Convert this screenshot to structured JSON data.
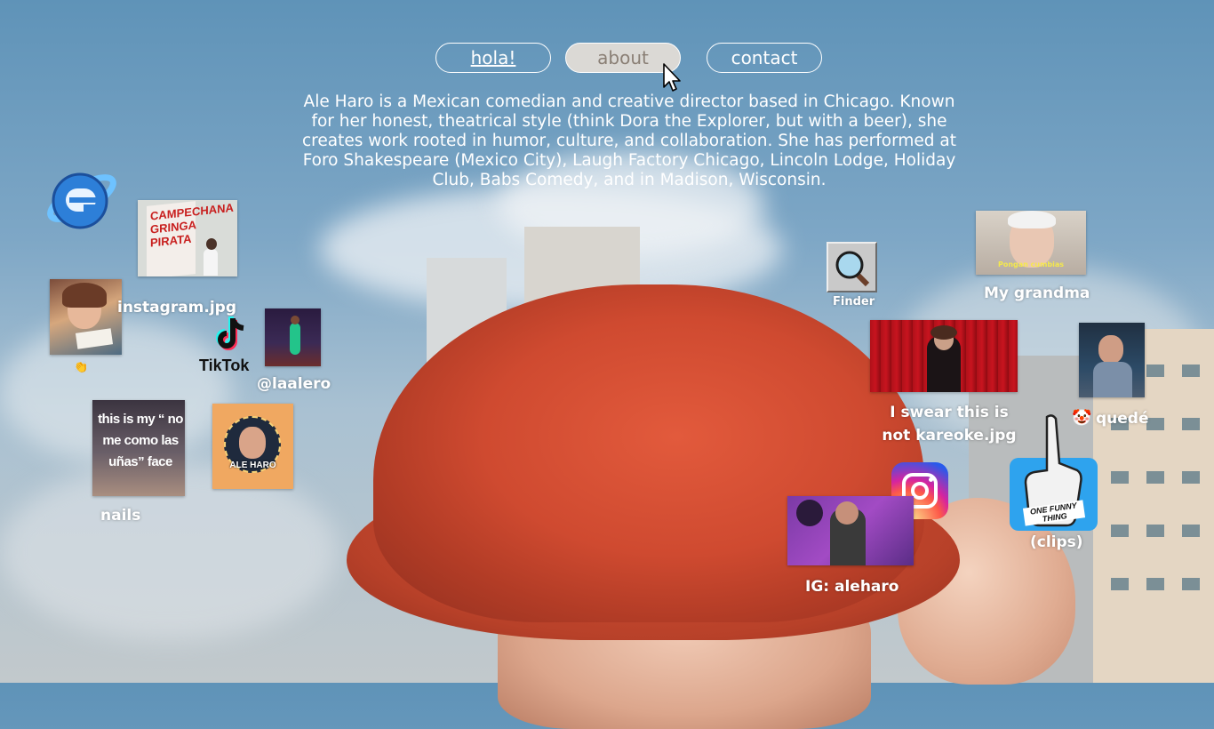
{
  "nav": {
    "hola_label": "hola!",
    "about_label": "about",
    "contact_label": "contact"
  },
  "bio": {
    "text": "Ale Haro is a Mexican comedian and creative director based in Chicago. Known for her honest, theatrical style (think Dora the Explorer, but with a beer), she creates work rooted in humor, culture, and collaboration. She has performed at Foro Shakespeare (Mexico City), Laugh Factory Chicago, Lincoln Lodge, Holiday Club,  Babs Comedy, and in Madison, Wisconsin."
  },
  "desktop_icons": {
    "instagram_jpg": "instagram.jpg",
    "clap_emoji": "👏",
    "tiktok_word": "TikTok",
    "tiktok_handle": "@laalero",
    "nails_caption": "this is my “ no me como las uñas” face",
    "nails_label": "nails",
    "poster_name": "ALE HARO",
    "campechana_sign": "CAMPECHANA GRINGA PIRATA",
    "finder_label": "Finder",
    "grandma_caption": "Pongan cumbias",
    "grandma_label": "My grandma",
    "kareoke_label": "I swear this is not kareoke.jpg",
    "quede_emoji": "🤡",
    "quede_label": "quedé",
    "ig_label": "IG: aleharo",
    "one_funny_thing": "ONE FUNNY THING",
    "clips_label": "(clips)"
  },
  "colors": {
    "sky_top": "#5f93b8",
    "hat": "#cf4a30",
    "nav_active_bg": "#e1dcd6",
    "tiktok_cyan": "#25f4ee",
    "tiktok_red": "#fe2c55",
    "ie_blue": "#2d7fd8",
    "clips_blue": "#2ea3ee"
  }
}
